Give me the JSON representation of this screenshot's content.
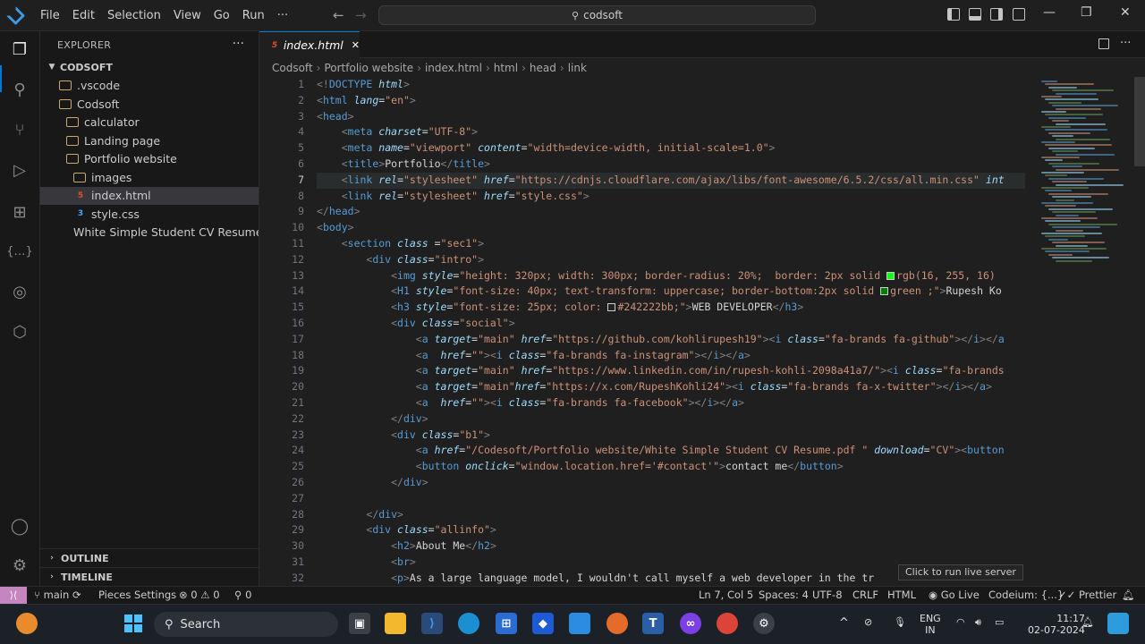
{
  "titlebar": {
    "menus": [
      "File",
      "Edit",
      "Selection",
      "View",
      "Go",
      "Run",
      "···"
    ],
    "search": "codsoft"
  },
  "sidebar": {
    "title": "EXPLORER",
    "root": "CODSOFT",
    "items": [
      {
        "label": ".vscode",
        "kind": "folder",
        "depth": 1
      },
      {
        "label": "Codsoft",
        "kind": "folder",
        "depth": 1
      },
      {
        "label": "calculator",
        "kind": "folder",
        "depth": 2
      },
      {
        "label": "Landing page",
        "kind": "folder",
        "depth": 2
      },
      {
        "label": "Portfolio website",
        "kind": "folder-open",
        "depth": 2
      },
      {
        "label": "images",
        "kind": "folder",
        "depth": 3
      },
      {
        "label": "index.html",
        "kind": "html",
        "depth": 3,
        "selected": true
      },
      {
        "label": "style.css",
        "kind": "css",
        "depth": 3
      },
      {
        "label": "White Simple Student CV Resume....",
        "kind": "pdf",
        "depth": 2
      }
    ],
    "outline": "OUTLINE",
    "timeline": "TIMELINE"
  },
  "editor": {
    "tab": "index.html",
    "breadcrumbs": [
      "Codsoft",
      "Portfolio website",
      "index.html",
      "html",
      "head",
      "link"
    ],
    "current_line": 7,
    "line_numbers": [
      "1",
      "2",
      "3",
      "4",
      "5",
      "6",
      "7",
      "8",
      "9",
      "10",
      "11",
      "12",
      "13",
      "14",
      "15",
      "16",
      "17",
      "18",
      "19",
      "20",
      "21",
      "22",
      "23",
      "24",
      "25",
      "26",
      "27",
      "28",
      "29",
      "30",
      "31",
      "32"
    ],
    "lines": [
      [
        [
          "pn",
          "<!"
        ],
        [
          "tg",
          "DOCTYPE"
        ],
        [
          "tx",
          " "
        ],
        [
          "at",
          "html"
        ],
        [
          "pn",
          ">"
        ]
      ],
      [
        [
          "pn",
          "<"
        ],
        [
          "tg",
          "html"
        ],
        [
          "tx",
          " "
        ],
        [
          "at",
          "lang"
        ],
        [
          "tx",
          "="
        ],
        [
          "st",
          "\"en\""
        ],
        [
          "pn",
          ">"
        ]
      ],
      [
        [
          "pn",
          "<"
        ],
        [
          "tg",
          "head"
        ],
        [
          "pn",
          ">"
        ]
      ],
      [
        [
          "tx",
          "    "
        ],
        [
          "pn",
          "<"
        ],
        [
          "tg",
          "meta"
        ],
        [
          "tx",
          " "
        ],
        [
          "at",
          "charset"
        ],
        [
          "tx",
          "="
        ],
        [
          "st",
          "\"UTF-8\""
        ],
        [
          "pn",
          ">"
        ]
      ],
      [
        [
          "tx",
          "    "
        ],
        [
          "pn",
          "<"
        ],
        [
          "tg",
          "meta"
        ],
        [
          "tx",
          " "
        ],
        [
          "at",
          "name"
        ],
        [
          "tx",
          "="
        ],
        [
          "st",
          "\"viewport\""
        ],
        [
          "tx",
          " "
        ],
        [
          "at",
          "content"
        ],
        [
          "tx",
          "="
        ],
        [
          "st",
          "\"width=device-width, initial-scale=1.0\""
        ],
        [
          "pn",
          ">"
        ]
      ],
      [
        [
          "tx",
          "    "
        ],
        [
          "pn",
          "<"
        ],
        [
          "tg",
          "title"
        ],
        [
          "pn",
          ">"
        ],
        [
          "tx",
          "Portfolio"
        ],
        [
          "pn",
          "</"
        ],
        [
          "tg",
          "title"
        ],
        [
          "pn",
          ">"
        ]
      ],
      [
        [
          "tx",
          "    "
        ],
        [
          "pn",
          "<"
        ],
        [
          "tg",
          "link"
        ],
        [
          "tx",
          " "
        ],
        [
          "at",
          "rel"
        ],
        [
          "tx",
          "="
        ],
        [
          "st",
          "\"stylesheet\""
        ],
        [
          "tx",
          " "
        ],
        [
          "at",
          "href"
        ],
        [
          "tx",
          "="
        ],
        [
          "st",
          "\"https://cdnjs.cloudflare.com/ajax/libs/font-awesome/6.5.2/css/all.min.css\""
        ],
        [
          "tx",
          " "
        ],
        [
          "at",
          "int"
        ]
      ],
      [
        [
          "tx",
          "    "
        ],
        [
          "pn",
          "<"
        ],
        [
          "tg",
          "link"
        ],
        [
          "tx",
          " "
        ],
        [
          "at",
          "rel"
        ],
        [
          "tx",
          "="
        ],
        [
          "st",
          "\"stylesheet\""
        ],
        [
          "tx",
          " "
        ],
        [
          "at",
          "href"
        ],
        [
          "tx",
          "="
        ],
        [
          "st",
          "\"style.css\""
        ],
        [
          "pn",
          ">"
        ]
      ],
      [
        [
          "pn",
          "</"
        ],
        [
          "tg",
          "head"
        ],
        [
          "pn",
          ">"
        ]
      ],
      [
        [
          "pn",
          "<"
        ],
        [
          "tg",
          "body"
        ],
        [
          "pn",
          ">"
        ]
      ],
      [
        [
          "tx",
          "    "
        ],
        [
          "pn",
          "<"
        ],
        [
          "tg",
          "section"
        ],
        [
          "tx",
          " "
        ],
        [
          "at",
          "class"
        ],
        [
          "tx",
          " ="
        ],
        [
          "st",
          "\"sec1\""
        ],
        [
          "pn",
          ">"
        ]
      ],
      [
        [
          "tx",
          "        "
        ],
        [
          "pn",
          "<"
        ],
        [
          "tg",
          "div"
        ],
        [
          "tx",
          " "
        ],
        [
          "at",
          "class"
        ],
        [
          "tx",
          "="
        ],
        [
          "st",
          "\"intro\""
        ],
        [
          "pn",
          ">"
        ]
      ],
      [
        [
          "tx",
          "            "
        ],
        [
          "pn",
          "<"
        ],
        [
          "tg",
          "img"
        ],
        [
          "tx",
          " "
        ],
        [
          "at",
          "style"
        ],
        [
          "tx",
          "="
        ],
        [
          "st",
          "\"height: 320px; width: 300px; border-radius: 20%;  border: 2px solid "
        ],
        [
          "sw1",
          ""
        ],
        [
          "st",
          "rgb(16, 255, 16)"
        ]
      ],
      [
        [
          "tx",
          "            "
        ],
        [
          "pn",
          "<"
        ],
        [
          "tg",
          "H1"
        ],
        [
          "tx",
          " "
        ],
        [
          "at",
          "style"
        ],
        [
          "tx",
          "="
        ],
        [
          "st",
          "\"font-size: 40px; text-transform: uppercase; border-bottom:2px solid "
        ],
        [
          "sw2",
          ""
        ],
        [
          "st",
          "green ;\""
        ],
        [
          "pn",
          ">"
        ],
        [
          "tx",
          "Rupesh Ko"
        ]
      ],
      [
        [
          "tx",
          "            "
        ],
        [
          "pn",
          "<"
        ],
        [
          "tg",
          "h3"
        ],
        [
          "tx",
          " "
        ],
        [
          "at",
          "style"
        ],
        [
          "tx",
          "="
        ],
        [
          "st",
          "\"font-size: 25px; color: "
        ],
        [
          "sw3",
          ""
        ],
        [
          "st",
          "#242222bb;\""
        ],
        [
          "pn",
          ">"
        ],
        [
          "tx",
          "WEB DEVELOPER"
        ],
        [
          "pn",
          "</"
        ],
        [
          "tg",
          "h3"
        ],
        [
          "pn",
          ">"
        ]
      ],
      [
        [
          "tx",
          "            "
        ],
        [
          "pn",
          "<"
        ],
        [
          "tg",
          "div"
        ],
        [
          "tx",
          " "
        ],
        [
          "at",
          "class"
        ],
        [
          "tx",
          "="
        ],
        [
          "st",
          "\"social\""
        ],
        [
          "pn",
          ">"
        ]
      ],
      [
        [
          "tx",
          "                "
        ],
        [
          "pn",
          "<"
        ],
        [
          "tg",
          "a"
        ],
        [
          "tx",
          " "
        ],
        [
          "at",
          "target"
        ],
        [
          "tx",
          "="
        ],
        [
          "st",
          "\"main\""
        ],
        [
          "tx",
          " "
        ],
        [
          "at",
          "href"
        ],
        [
          "tx",
          "="
        ],
        [
          "st",
          "\"https://github.com/kohlirupesh19\""
        ],
        [
          "pn",
          "><"
        ],
        [
          "tg",
          "i"
        ],
        [
          "tx",
          " "
        ],
        [
          "at",
          "class"
        ],
        [
          "tx",
          "="
        ],
        [
          "st",
          "\"fa-brands fa-github\""
        ],
        [
          "pn",
          "></"
        ],
        [
          "tg",
          "i"
        ],
        [
          "pn",
          "></"
        ],
        [
          "tg",
          "a"
        ]
      ],
      [
        [
          "tx",
          "                "
        ],
        [
          "pn",
          "<"
        ],
        [
          "tg",
          "a"
        ],
        [
          "tx",
          "  "
        ],
        [
          "at",
          "href"
        ],
        [
          "tx",
          "="
        ],
        [
          "st",
          "\"\""
        ],
        [
          "pn",
          "><"
        ],
        [
          "tg",
          "i"
        ],
        [
          "tx",
          " "
        ],
        [
          "at",
          "class"
        ],
        [
          "tx",
          "="
        ],
        [
          "st",
          "\"fa-brands fa-instagram\""
        ],
        [
          "pn",
          "></"
        ],
        [
          "tg",
          "i"
        ],
        [
          "pn",
          "></"
        ],
        [
          "tg",
          "a"
        ],
        [
          "pn",
          ">"
        ]
      ],
      [
        [
          "tx",
          "                "
        ],
        [
          "pn",
          "<"
        ],
        [
          "tg",
          "a"
        ],
        [
          "tx",
          " "
        ],
        [
          "at",
          "target"
        ],
        [
          "tx",
          "="
        ],
        [
          "st",
          "\"main\""
        ],
        [
          "tx",
          " "
        ],
        [
          "at",
          "href"
        ],
        [
          "tx",
          "="
        ],
        [
          "st",
          "\"https://www.linkedin.com/in/rupesh-kohli-2098a41a7/\""
        ],
        [
          "pn",
          "><"
        ],
        [
          "tg",
          "i"
        ],
        [
          "tx",
          " "
        ],
        [
          "at",
          "class"
        ],
        [
          "tx",
          "="
        ],
        [
          "st",
          "\"fa-brands"
        ]
      ],
      [
        [
          "tx",
          "                "
        ],
        [
          "pn",
          "<"
        ],
        [
          "tg",
          "a"
        ],
        [
          "tx",
          " "
        ],
        [
          "at",
          "target"
        ],
        [
          "tx",
          "="
        ],
        [
          "st",
          "\"main\""
        ],
        [
          "at",
          "href"
        ],
        [
          "tx",
          "="
        ],
        [
          "st",
          "\"https://x.com/RupeshKohli24\""
        ],
        [
          "pn",
          "><"
        ],
        [
          "tg",
          "i"
        ],
        [
          "tx",
          " "
        ],
        [
          "at",
          "class"
        ],
        [
          "tx",
          "="
        ],
        [
          "st",
          "\"fa-brands fa-x-twitter\""
        ],
        [
          "pn",
          "></"
        ],
        [
          "tg",
          "i"
        ],
        [
          "pn",
          "></"
        ],
        [
          "tg",
          "a"
        ],
        [
          "pn",
          ">"
        ]
      ],
      [
        [
          "tx",
          "                "
        ],
        [
          "pn",
          "<"
        ],
        [
          "tg",
          "a"
        ],
        [
          "tx",
          "  "
        ],
        [
          "at",
          "href"
        ],
        [
          "tx",
          "="
        ],
        [
          "st",
          "\"\""
        ],
        [
          "pn",
          "><"
        ],
        [
          "tg",
          "i"
        ],
        [
          "tx",
          " "
        ],
        [
          "at",
          "class"
        ],
        [
          "tx",
          "="
        ],
        [
          "st",
          "\"fa-brands fa-facebook\""
        ],
        [
          "pn",
          "></"
        ],
        [
          "tg",
          "i"
        ],
        [
          "pn",
          "></"
        ],
        [
          "tg",
          "a"
        ],
        [
          "pn",
          ">"
        ]
      ],
      [
        [
          "tx",
          "            "
        ],
        [
          "pn",
          "</"
        ],
        [
          "tg",
          "div"
        ],
        [
          "pn",
          ">"
        ]
      ],
      [
        [
          "tx",
          "            "
        ],
        [
          "pn",
          "<"
        ],
        [
          "tg",
          "div"
        ],
        [
          "tx",
          " "
        ],
        [
          "at",
          "class"
        ],
        [
          "tx",
          "="
        ],
        [
          "st",
          "\"b1\""
        ],
        [
          "pn",
          ">"
        ]
      ],
      [
        [
          "tx",
          "                "
        ],
        [
          "pn",
          "<"
        ],
        [
          "tg",
          "a"
        ],
        [
          "tx",
          " "
        ],
        [
          "at",
          "href"
        ],
        [
          "tx",
          "="
        ],
        [
          "st",
          "\"/Codesoft/Portfolio website/White Simple Student CV Resume.pdf \""
        ],
        [
          "tx",
          " "
        ],
        [
          "at",
          "download"
        ],
        [
          "tx",
          "="
        ],
        [
          "st",
          "\"CV\""
        ],
        [
          "pn",
          "><"
        ],
        [
          "tg",
          "button"
        ]
      ],
      [
        [
          "tx",
          "                "
        ],
        [
          "pn",
          "<"
        ],
        [
          "tg",
          "button"
        ],
        [
          "tx",
          " "
        ],
        [
          "at",
          "onclick"
        ],
        [
          "tx",
          "="
        ],
        [
          "st",
          "\"window.location.href='#contact'\""
        ],
        [
          "pn",
          ">"
        ],
        [
          "tx",
          "contact me"
        ],
        [
          "pn",
          "</"
        ],
        [
          "tg",
          "button"
        ],
        [
          "pn",
          ">"
        ]
      ],
      [
        [
          "tx",
          "            "
        ],
        [
          "pn",
          "</"
        ],
        [
          "tg",
          "div"
        ],
        [
          "pn",
          ">"
        ]
      ],
      [
        [
          "tx",
          ""
        ]
      ],
      [
        [
          "tx",
          "        "
        ],
        [
          "pn",
          "</"
        ],
        [
          "tg",
          "div"
        ],
        [
          "pn",
          ">"
        ]
      ],
      [
        [
          "tx",
          "        "
        ],
        [
          "pn",
          "<"
        ],
        [
          "tg",
          "div"
        ],
        [
          "tx",
          " "
        ],
        [
          "at",
          "class"
        ],
        [
          "tx",
          "="
        ],
        [
          "st",
          "\"allinfo\""
        ],
        [
          "pn",
          ">"
        ]
      ],
      [
        [
          "tx",
          "            "
        ],
        [
          "pn",
          "<"
        ],
        [
          "tg",
          "h2"
        ],
        [
          "pn",
          ">"
        ],
        [
          "tx",
          "About Me"
        ],
        [
          "pn",
          "</"
        ],
        [
          "tg",
          "h2"
        ],
        [
          "pn",
          ">"
        ]
      ],
      [
        [
          "tx",
          "            "
        ],
        [
          "pn",
          "<"
        ],
        [
          "tg",
          "br"
        ],
        [
          "pn",
          ">"
        ]
      ],
      [
        [
          "tx",
          "            "
        ],
        [
          "pn",
          "<"
        ],
        [
          "tg",
          "p"
        ],
        [
          "pn",
          ">"
        ],
        [
          "tx",
          "As a large language model, I wouldn't call myself a web developer in the tr"
        ]
      ]
    ],
    "swatch_colors": {
      "sw1": "#10ff10",
      "sw2": "#008000",
      "sw3": "#242222"
    },
    "tooltip": "Click to run live server"
  },
  "statusbar": {
    "branch": "main",
    "pieces": "Pieces Settings",
    "problems": "⊗ 0 ⚠ 0",
    "ports": "⚲ 0",
    "position": "Ln 7, Col 5",
    "spaces": "Spaces: 4",
    "encoding": "UTF-8",
    "eol": "CRLF",
    "language": "HTML",
    "golive": "Go Live",
    "codeium": "Codeium: {...}",
    "prettier": "Prettier"
  },
  "taskbar": {
    "search": "Search",
    "lang": "ENG",
    "region": "IN",
    "time": "11:17",
    "date": "02-07-2024"
  },
  "colors": {
    "accent": "#0078d4",
    "remote": "#c586c0"
  }
}
